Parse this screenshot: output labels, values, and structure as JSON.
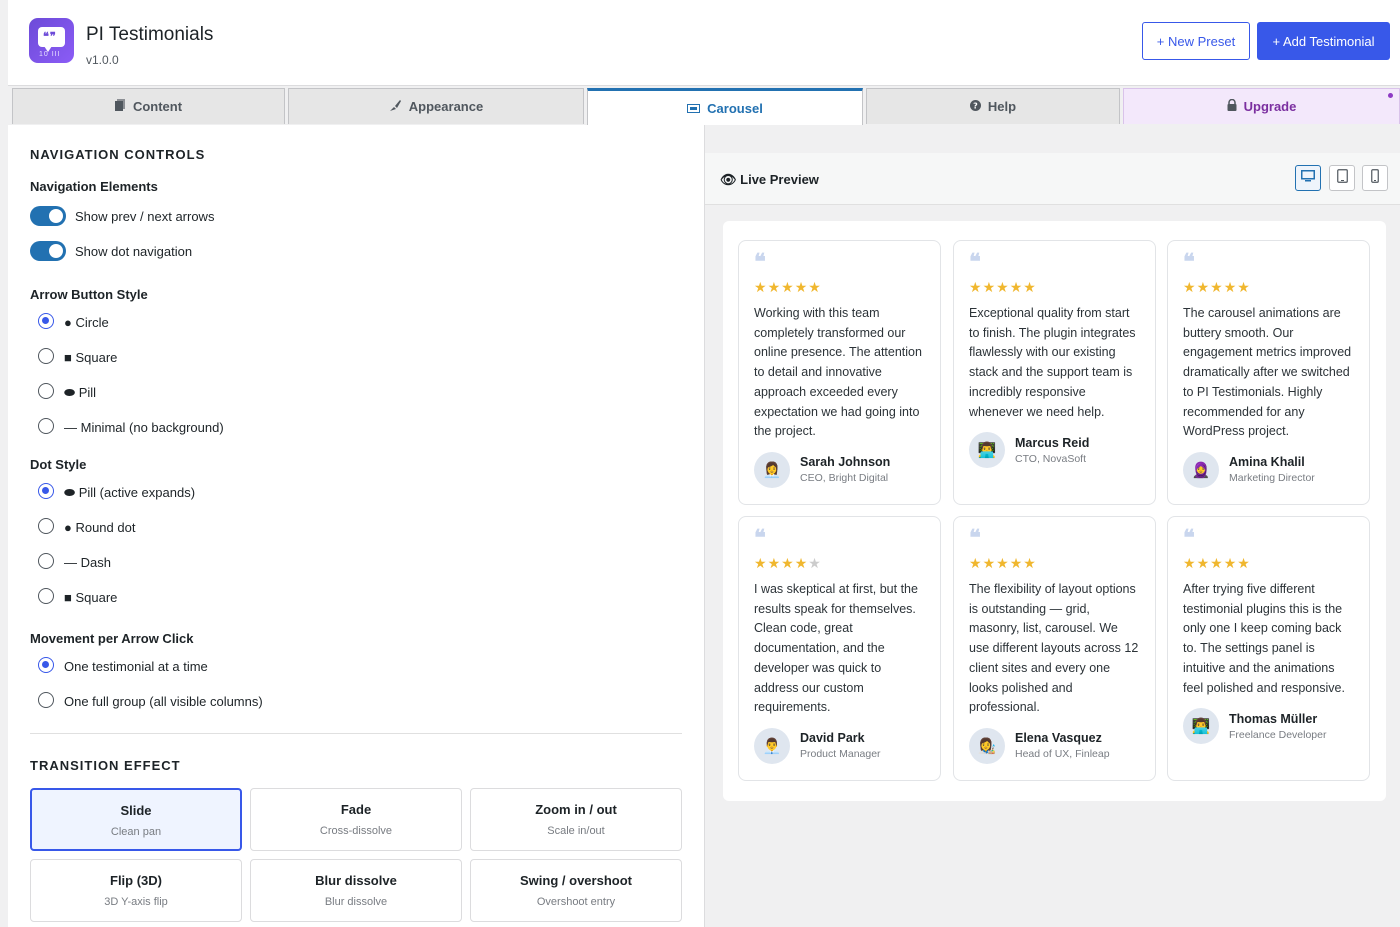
{
  "app": {
    "title": "PI Testimonials",
    "version": "v1.0.0"
  },
  "header": {
    "new_preset": "+ New Preset",
    "add_testimonial": "+ Add Testimonial"
  },
  "tabs": [
    {
      "label": "Content",
      "icon": "page-icon"
    },
    {
      "label": "Appearance",
      "icon": "brush-icon"
    },
    {
      "label": "Carousel",
      "icon": "carousel-icon"
    },
    {
      "label": "Help",
      "icon": "help-icon"
    },
    {
      "label": "Upgrade",
      "icon": "lock-icon"
    }
  ],
  "nav": {
    "section": "NAVIGATION CONTROLS",
    "elements_label": "Navigation Elements",
    "toggles": [
      {
        "label": "Show prev / next arrows",
        "on": true
      },
      {
        "label": "Show dot navigation",
        "on": true
      }
    ],
    "arrow_style_label": "Arrow Button Style",
    "arrow_styles": [
      {
        "label": "● Circle",
        "checked": true
      },
      {
        "label": "■ Square",
        "checked": false
      },
      {
        "label": "⬬ Pill",
        "checked": false
      },
      {
        "label": "— Minimal (no background)",
        "checked": false
      }
    ],
    "dot_style_label": "Dot Style",
    "dot_styles": [
      {
        "label": "⬬ Pill (active expands)",
        "checked": true
      },
      {
        "label": "● Round dot",
        "checked": false
      },
      {
        "label": "— Dash",
        "checked": false
      },
      {
        "label": "■ Square",
        "checked": false
      }
    ],
    "movement_label": "Movement per Arrow Click",
    "movement": [
      {
        "label": "One testimonial at a time",
        "checked": true
      },
      {
        "label": "One full group (all visible columns)",
        "checked": false
      }
    ]
  },
  "transition": {
    "section": "TRANSITION EFFECT",
    "options": [
      {
        "title": "Slide",
        "sub": "Clean pan",
        "selected": true
      },
      {
        "title": "Fade",
        "sub": "Cross-dissolve",
        "selected": false
      },
      {
        "title": "Zoom in / out",
        "sub": "Scale in/out",
        "selected": false
      },
      {
        "title": "Flip (3D)",
        "sub": "3D Y-axis flip",
        "selected": false
      },
      {
        "title": "Blur dissolve",
        "sub": "Blur dissolve",
        "selected": false
      },
      {
        "title": "Swing / overshoot",
        "sub": "Overshoot entry",
        "selected": false
      }
    ]
  },
  "preview": {
    "title": "Live Preview",
    "eye_icon": "👁",
    "devices": [
      "desktop-icon",
      "tablet-icon",
      "mobile-icon"
    ],
    "quote_mark": "❝",
    "testimonials": [
      {
        "stars": 5,
        "text": "Working with this team completely transformed our online presence. The attention to detail and innovative approach exceeded every expectation we had going into the project.",
        "name": "Sarah Johnson",
        "role": "CEO, Bright Digital",
        "avatar": "👩‍💼"
      },
      {
        "stars": 5,
        "text": "Exceptional quality from start to finish. The plugin integrates flawlessly with our existing stack and the support team is incredibly responsive whenever we need help.",
        "name": "Marcus Reid",
        "role": "CTO, NovaSoft",
        "avatar": "👨‍💻"
      },
      {
        "stars": 5,
        "text": "The carousel animations are buttery smooth. Our engagement metrics improved dramatically after we switched to PI Testimonials. Highly recommended for any WordPress project.",
        "name": "Amina Khalil",
        "role": "Marketing Director",
        "avatar": "🧕"
      },
      {
        "stars": 4,
        "text": "I was skeptical at first, but the results speak for themselves. Clean code, great documentation, and the developer was quick to address our custom requirements.",
        "name": "David Park",
        "role": "Product Manager",
        "avatar": "👨‍💼"
      },
      {
        "stars": 5,
        "text": "The flexibility of layout options is outstanding — grid, masonry, list, carousel. We use different layouts across 12 client sites and every one looks polished and professional.",
        "name": "Elena Vasquez",
        "role": "Head of UX, Finleap",
        "avatar": "👩‍🎨"
      },
      {
        "stars": 5,
        "text": "After trying five different testimonial plugins this is the only one I keep coming back to. The settings panel is intuitive and the animations feel polished and responsive.",
        "name": "Thomas Müller",
        "role": "Freelance Developer",
        "avatar": "👨‍💻"
      }
    ]
  }
}
